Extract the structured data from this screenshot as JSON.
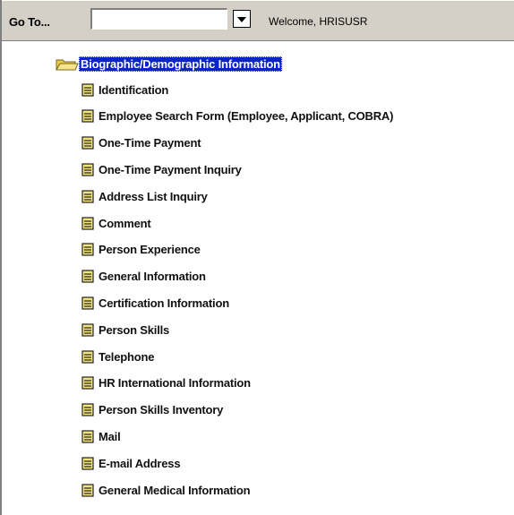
{
  "toolbar": {
    "goto_label": "Go To...",
    "goto_value": "",
    "welcome_text": "Welcome, HRISUSR"
  },
  "tree": {
    "folder": {
      "label": "Biographic/Demographic Information",
      "icon": "open-folder-icon"
    },
    "items": [
      {
        "label": "Identification",
        "icon": "document-icon"
      },
      {
        "label": "Employee Search Form (Employee, Applicant, COBRA)",
        "icon": "document-icon"
      },
      {
        "label": "One-Time Payment",
        "icon": "document-icon"
      },
      {
        "label": "One-Time Payment Inquiry",
        "icon": "document-icon"
      },
      {
        "label": "Address List Inquiry",
        "icon": "document-icon"
      },
      {
        "label": "Comment",
        "icon": "document-icon"
      },
      {
        "label": "Person Experience",
        "icon": "document-icon"
      },
      {
        "label": "General Information",
        "icon": "document-icon"
      },
      {
        "label": "Certification Information",
        "icon": "document-icon"
      },
      {
        "label": "Person Skills",
        "icon": "document-icon"
      },
      {
        "label": "Telephone",
        "icon": "document-icon"
      },
      {
        "label": "HR International Information",
        "icon": "document-icon"
      },
      {
        "label": "Person Skills Inventory",
        "icon": "document-icon"
      },
      {
        "label": "Mail",
        "icon": "document-icon"
      },
      {
        "label": "E-mail Address",
        "icon": "document-icon"
      },
      {
        "label": "General Medical Information",
        "icon": "document-icon"
      }
    ]
  },
  "colors": {
    "selection": "#0a24c8",
    "toolbar_bg": "#d4d0c8",
    "doc_icon_fill": "#f2e27a"
  }
}
